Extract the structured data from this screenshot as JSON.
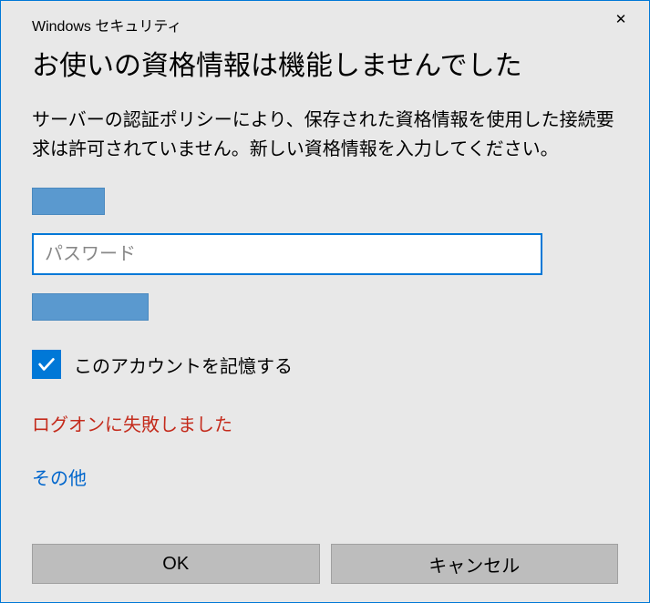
{
  "titlebar": {
    "text": "Windows セキュリティ"
  },
  "heading": "お使いの資格情報は機能しませんでした",
  "description": "サーバーの認証ポリシーにより、保存された資格情報を使用した接続要求は許可されていません。新しい資格情報を入力してください。",
  "password": {
    "placeholder": "パスワード",
    "value": ""
  },
  "remember": {
    "label": "このアカウントを記憶する",
    "checked": true
  },
  "error": "ログオンに失敗しました",
  "more_link": "その他",
  "buttons": {
    "ok": "OK",
    "cancel": "キャンセル"
  }
}
